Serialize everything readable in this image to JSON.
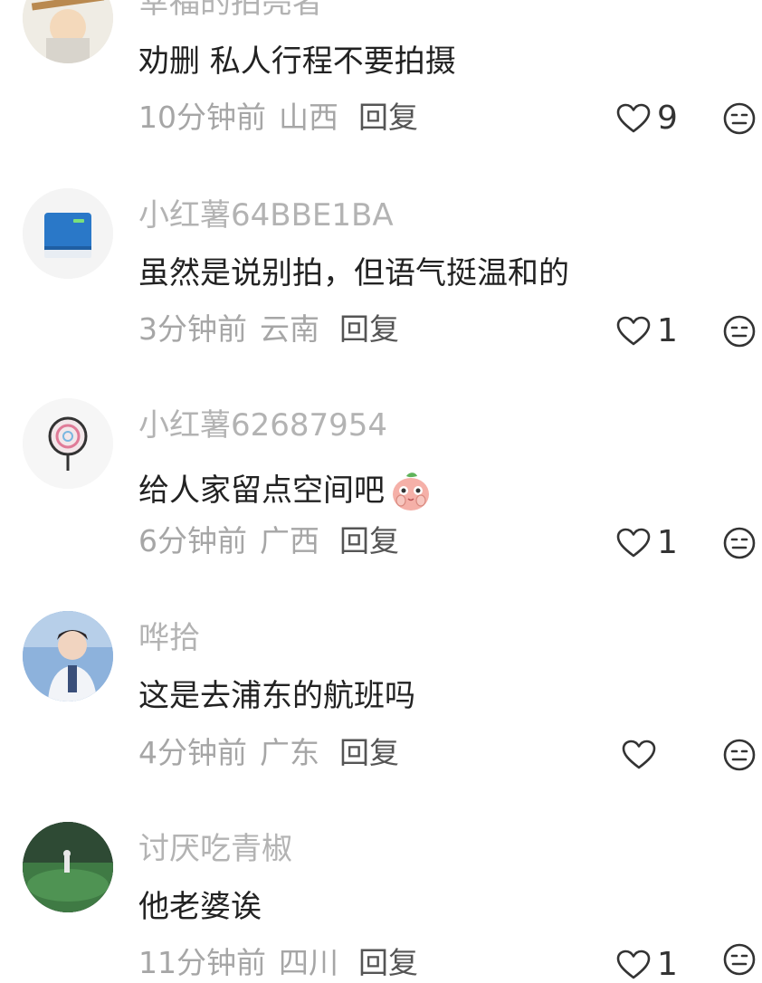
{
  "comments": [
    {
      "username": "幸福的拍亮者",
      "text": "劝删 私人行程不要拍摄",
      "time": "10分钟前",
      "region": "山西",
      "reply_label": "回复",
      "likes": "9",
      "avatar_icon": "cartoon-avatar-icon"
    },
    {
      "username": "小红薯64BBE1BA",
      "text": "虽然是说别拍，但语气挺温和的",
      "time": "3分钟前",
      "region": "云南",
      "reply_label": "回复",
      "likes": "1",
      "avatar_icon": "blue-book-icon"
    },
    {
      "username": "小红薯62687954",
      "text": "给人家留点空间吧",
      "time": "6分钟前",
      "region": "广西",
      "reply_label": "回复",
      "likes": "1",
      "avatar_icon": "lollipop-icon",
      "inline_emoji": "peach-face-emoji"
    },
    {
      "username": "哗拾",
      "text": "这是去浦东的航班吗",
      "time": "4分钟前",
      "region": "广东",
      "reply_label": "回复",
      "likes": "",
      "avatar_icon": "photo-avatar-icon"
    },
    {
      "username": "讨厌吃青椒",
      "text": "他老婆诶",
      "time": "11分钟前",
      "region": "四川",
      "reply_label": "回复",
      "likes": "1",
      "avatar_icon": "field-photo-avatar-icon"
    }
  ],
  "colors": {
    "username": "#b3b3b3",
    "text": "#222222",
    "meta": "#a6a6a6",
    "reply": "#555555"
  }
}
